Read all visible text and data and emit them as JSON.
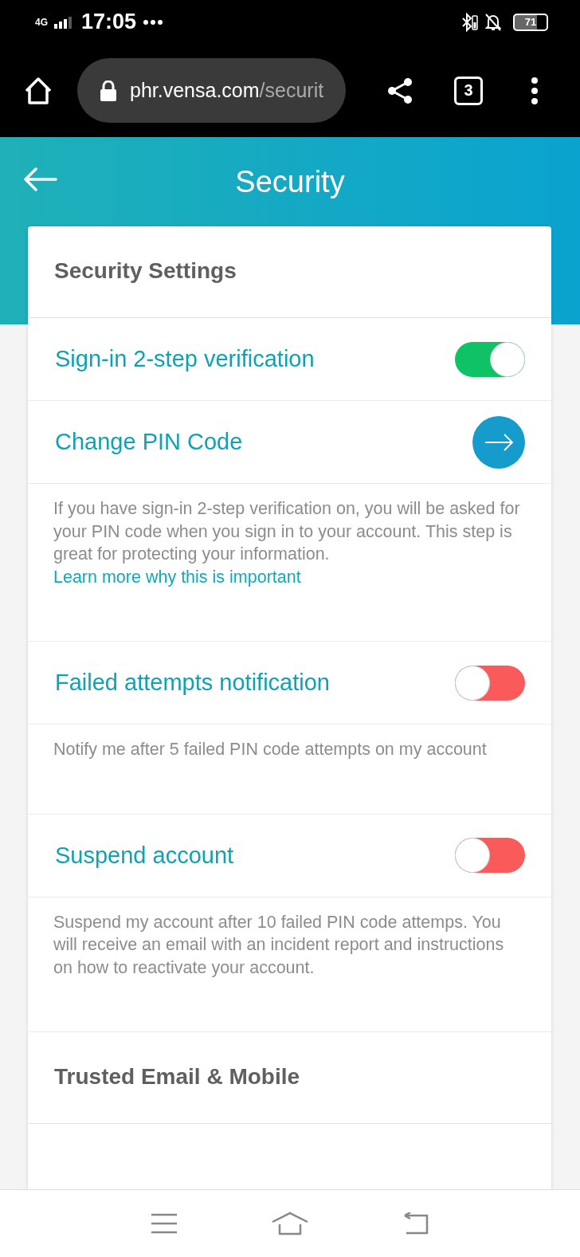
{
  "status_bar": {
    "network": "4G",
    "time": "17:05",
    "battery": "71"
  },
  "browser": {
    "url_host": "phr.vensa.com",
    "url_path": "/securit",
    "tab_count": "3"
  },
  "header": {
    "title": "Security"
  },
  "card": {
    "title": "Security Settings",
    "items": [
      {
        "kind": "toggle",
        "label": "Sign-in 2-step verification",
        "on": true
      },
      {
        "kind": "link",
        "label": "Change PIN Code"
      },
      {
        "kind": "note",
        "text": "If you have sign-in 2-step verification on, you will be asked for your PIN code when you sign in to your account. This step is great for protecting your information.",
        "link": "Learn more why this is important"
      },
      {
        "kind": "toggle",
        "label": "Failed attempts notification",
        "on": false
      },
      {
        "kind": "note",
        "text": "Notify me after 5 failed PIN code attempts on my account"
      },
      {
        "kind": "toggle",
        "label": "Suspend account",
        "on": false
      },
      {
        "kind": "note",
        "text": "Suspend my account after 10 failed PIN code attemps. You will receive an email with an incident report and instructions on how to reactivate your account."
      },
      {
        "kind": "heading",
        "label": "Trusted Email & Mobile"
      }
    ]
  }
}
